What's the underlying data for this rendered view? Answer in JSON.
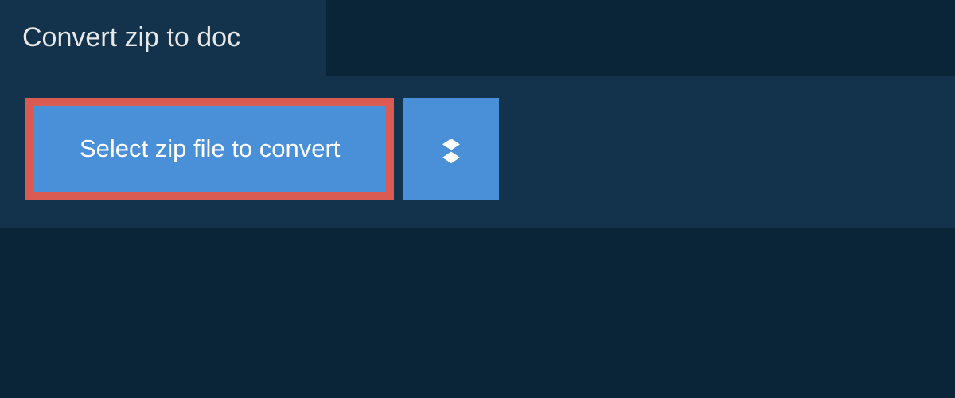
{
  "tab": {
    "label": "Convert zip to doc"
  },
  "buttons": {
    "select_label": "Select zip file to convert"
  },
  "colors": {
    "background": "#0a2438",
    "panel": "#13334d",
    "button": "#4a90d9",
    "highlight_border": "#d95b52",
    "text_light": "#e8e8e8",
    "text_white": "#ffffff"
  }
}
